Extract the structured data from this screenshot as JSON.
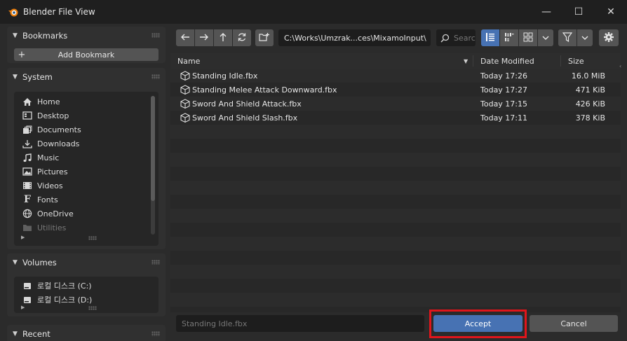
{
  "window": {
    "title": "Blender File View",
    "minimize_glyph": "—",
    "maximize_glyph": "☐",
    "close_glyph": "✕"
  },
  "sidebar": {
    "bookmarks": {
      "title": "Bookmarks",
      "add_label": "Add Bookmark"
    },
    "system": {
      "title": "System",
      "items": [
        {
          "label": "Home",
          "icon": "home-icon"
        },
        {
          "label": "Desktop",
          "icon": "desktop-icon"
        },
        {
          "label": "Documents",
          "icon": "documents-icon"
        },
        {
          "label": "Downloads",
          "icon": "downloads-icon"
        },
        {
          "label": "Music",
          "icon": "music-icon"
        },
        {
          "label": "Pictures",
          "icon": "pictures-icon"
        },
        {
          "label": "Videos",
          "icon": "videos-icon"
        },
        {
          "label": "Fonts",
          "icon": "fonts-icon"
        },
        {
          "label": "OneDrive",
          "icon": "onedrive-icon"
        },
        {
          "label": "Utilities",
          "icon": "folder-icon"
        }
      ]
    },
    "volumes": {
      "title": "Volumes",
      "items": [
        {
          "label": "로컬 디스크 (C:)",
          "icon": "disk-icon"
        },
        {
          "label": "로컬 디스크 (D:)",
          "icon": "disk-icon"
        }
      ]
    },
    "recent": {
      "title": "Recent"
    }
  },
  "toolbar": {
    "path": "C:\\Works\\Umzrak...ces\\MixamoInput\\",
    "search_placeholder": "Search"
  },
  "files": {
    "columns": {
      "name": "Name",
      "date": "Date Modified",
      "size": "Size"
    },
    "rows": [
      {
        "name": "Standing Idle.fbx",
        "date": "Today 17:26",
        "size": "16.0 MiB"
      },
      {
        "name": "Standing Melee Attack Downward.fbx",
        "date": "Today 17:27",
        "size": "471 KiB"
      },
      {
        "name": "Sword And Shield Attack.fbx",
        "date": "Today 17:15",
        "size": "426 KiB"
      },
      {
        "name": "Sword And Shield Slash.fbx",
        "date": "Today 17:11",
        "size": "378 KiB"
      }
    ]
  },
  "footer": {
    "filename": "Standing Idle.fbx",
    "accept_label": "Accept",
    "cancel_label": "Cancel"
  },
  "colors": {
    "accent": "#4772b3",
    "highlight": "#e0151b",
    "active_view": "#4772b3"
  }
}
